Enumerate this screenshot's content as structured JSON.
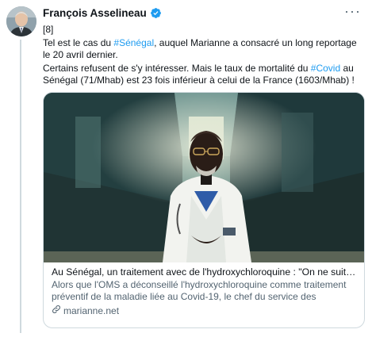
{
  "tweet": {
    "author_name": "François Asselineau",
    "more_label": "···",
    "text": {
      "line_index": "[8]",
      "p1_pre": "Tel est le cas du ",
      "p1_tag": "#Sénégal",
      "p1_post": ", auquel Marianne a consacré un long reportage le 20 avril dernier.",
      "p2_pre": "Certains refusent de s'y intéresser. Mais le taux de mortalité du ",
      "p2_tag": "#Covid",
      "p2_post": " au Sénégal (71/Mhab) est 23 fois inférieur à celui de la France (1603/Mhab) !"
    }
  },
  "card": {
    "title": "Au Sénégal, un traitement avec de l'hydroxychloroquine : \"On ne suit p...",
    "description": "Alors que l'OMS a déconseillé l'hydroxychloroquine comme traitement préventif de la maladie liée au Covid-19, le chef du service des maladie...",
    "domain": "marianne.net"
  },
  "colors": {
    "link": "#1d9bf0",
    "verified": "#1d9bf0",
    "secondary_text": "#536471",
    "thread_line": "#cfd9de"
  },
  "icons": {
    "verified": "verified-badge-icon",
    "more": "more-options-icon",
    "link": "link-icon"
  }
}
